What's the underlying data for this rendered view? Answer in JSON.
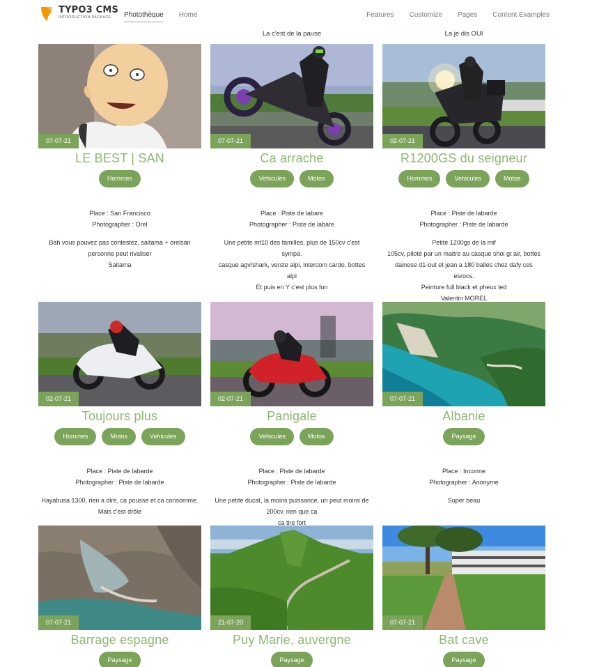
{
  "header": {
    "logo_title": "TYPO3 CMS",
    "logo_subtitle": "INTRODUCTION PACKAGE",
    "nav_left": [
      "Photothèque",
      "Home"
    ],
    "nav_right": [
      "Features",
      "Customize",
      "Pages",
      "Content Examples"
    ]
  },
  "previous_row": {
    "caption_middle": "La c'est de la pause",
    "caption_right": "La je dis OUI"
  },
  "cards": [
    {
      "date": "07-07-21",
      "title": "LE BEST | SAN",
      "tags": [
        "Hommes"
      ],
      "place": "Place : San Francisco",
      "photographer": "Photographer : Orel",
      "description": [
        "Bah vous pouvez pas contestez, saitama + orelsan personne peut rivaliser",
        "Saitama"
      ]
    },
    {
      "date": "07-07-21",
      "title": "Ca arrache",
      "tags": [
        "Vehicules",
        "Motos"
      ],
      "place": "Place : Piste de labare",
      "photographer": "Photographer : Piste de labare",
      "description": [
        "Une petite mt10 des familles, plus de 150cv c'est sympa.",
        "casque agv/shark, verste alpi, intercom cardo, bottes alpi",
        "Et puis en Y c'est plus fun"
      ]
    },
    {
      "date": "02-07-21",
      "title": "R1200GS du seigneur",
      "tags": [
        "Hommes",
        "Vehicules",
        "Motos"
      ],
      "place": "Place : Piste de labarde",
      "photographer": "Photographer : Piste de labarde",
      "description": [
        "Petite 1200gs de la mif",
        "105cv, piloté par un maitre au casque shoi gt air, bottes dainese d1-out et jean a 180 balles chez dafy ces esrocs.",
        "Peinture full black et pheux led",
        "Valentin MOREL"
      ]
    },
    {
      "date": "02-07-21",
      "title": "Toujours plus",
      "tags": [
        "Hommes",
        "Motos",
        "Vehicules"
      ],
      "place": "Place : Piste de labarde",
      "photographer": "Photographer : Piste de labarde",
      "description": [
        "Hayabusa 1300, rien a dire, ca pousse et ca consomme. Mais c'est drôle"
      ]
    },
    {
      "date": "02-07-21",
      "title": "Panigale",
      "tags": [
        "Vehicules",
        "Motos"
      ],
      "place": "Place : Piste de labarde",
      "photographer": "Photographer : Piste de labarde",
      "description": [
        "Une petite ducat, la moins puissance, un peut moins de 200cv. rien que ca",
        "ca tire fort"
      ]
    },
    {
      "date": "07-07-21",
      "title": "Albanie",
      "tags": [
        "Paysage"
      ],
      "place": "Place : Inconne",
      "photographer": "Photographer : Anonyme",
      "description": [
        "Super beau"
      ]
    },
    {
      "date": "07-07-21",
      "title": "Barrage espagne",
      "tags": [
        "Paysage"
      ],
      "place": "",
      "photographer": "",
      "description": []
    },
    {
      "date": "21-07-20",
      "title": "Puy Marie, auvergne",
      "tags": [
        "Paysage"
      ],
      "place": "",
      "photographer": "",
      "description": []
    },
    {
      "date": "07-07-21",
      "title": "Bat cave",
      "tags": [
        "Paysage"
      ],
      "place": "",
      "photographer": "",
      "description": []
    }
  ]
}
